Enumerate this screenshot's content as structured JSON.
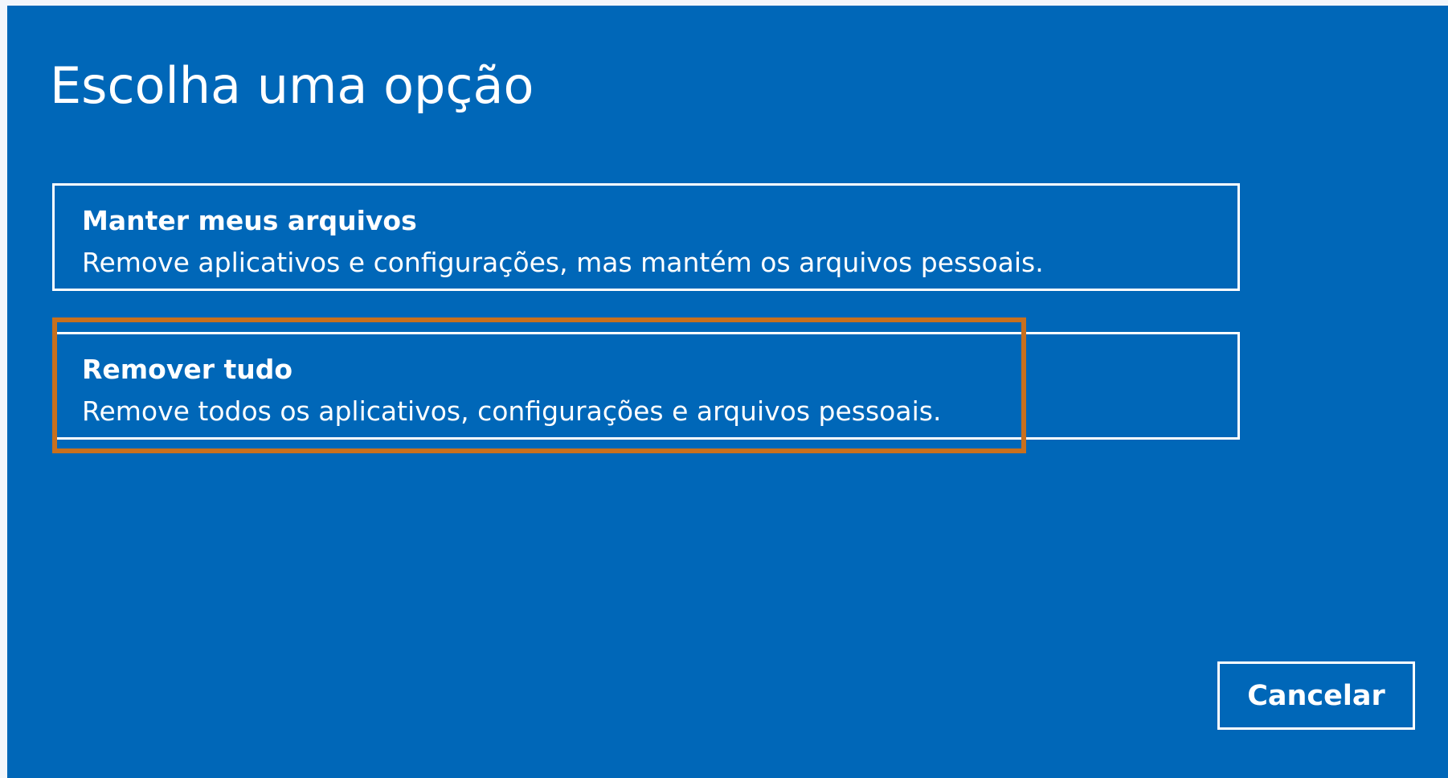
{
  "dialog": {
    "title": "Escolha uma opção",
    "background_color": "#0067b8",
    "options": [
      {
        "title": "Manter meus arquivos",
        "description": "Remove aplicativos e configurações, mas mantém os arquivos pessoais."
      },
      {
        "title": "Remover tudo",
        "description": "Remove todos os aplicativos, configurações e arquivos pessoais.",
        "highlighted": true
      }
    ],
    "highlight_color": "#c8701e",
    "cancel_label": "Cancelar"
  }
}
